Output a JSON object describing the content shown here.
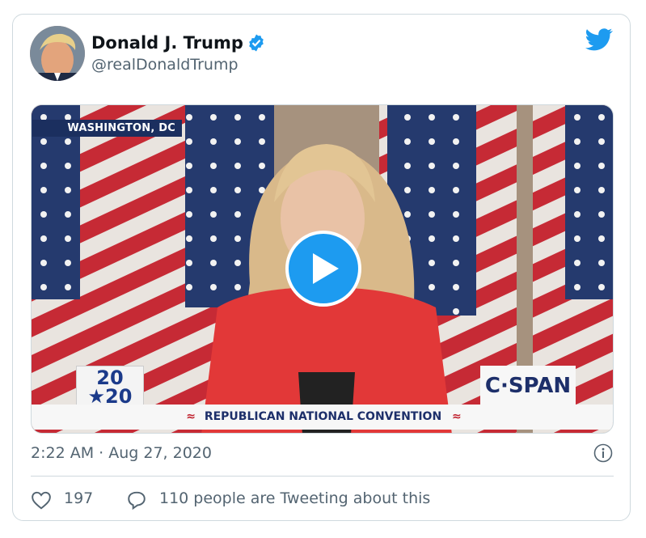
{
  "author": {
    "name": "Donald J. Trump",
    "handle": "@realDonaldTrump",
    "verified": true,
    "verified_icon": "verified-badge-icon"
  },
  "media": {
    "location_banner": "WASHINGTON, DC",
    "logo_2020_top": "20",
    "logo_2020_bottom": "★20",
    "network_logo": "C·SPAN",
    "lower_third": "REPUBLICAN NATIONAL CONVENTION",
    "play_icon": "play-icon"
  },
  "footer": {
    "timestamp": "2:22 AM · Aug 27, 2020",
    "likes": "197",
    "tweeting": "110 people are Tweeting about this"
  },
  "colors": {
    "accent": "#1d9bf0",
    "muted_text": "#536471",
    "border": "#cfd9de"
  }
}
